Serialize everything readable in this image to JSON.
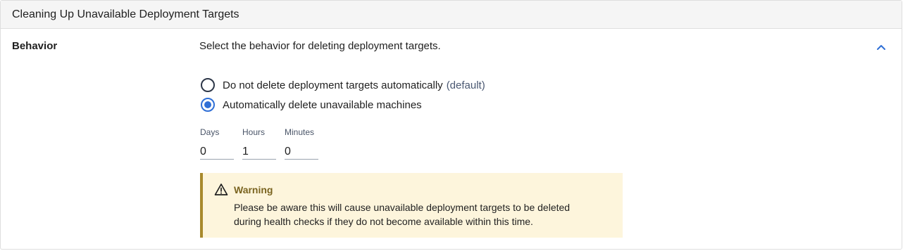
{
  "panel": {
    "title": "Cleaning Up Unavailable Deployment Targets"
  },
  "behavior": {
    "label": "Behavior",
    "description": "Select the behavior for deleting deployment targets.",
    "collapse_icon": "chevron-up-icon",
    "options": [
      {
        "label": "Do not delete deployment targets automatically",
        "suffix": "(default)",
        "selected": false
      },
      {
        "label": "Automatically delete unavailable machines",
        "suffix": "",
        "selected": true
      }
    ]
  },
  "duration": {
    "days_label": "Days",
    "days_value": "0",
    "hours_label": "Hours",
    "hours_value": "1",
    "minutes_label": "Minutes",
    "minutes_value": "0"
  },
  "warning": {
    "icon": "warning-triangle-icon",
    "title": "Warning",
    "line1": "Please be aware this will cause unavailable deployment targets to be deleted",
    "line2": "during health checks if they do not become available within this time."
  },
  "colors": {
    "accent": "#2f6fd6",
    "warning_bg": "#fdf5dc",
    "warning_border": "#a8892c",
    "warning_title": "#7a6420",
    "header_bg": "#f5f5f5"
  }
}
